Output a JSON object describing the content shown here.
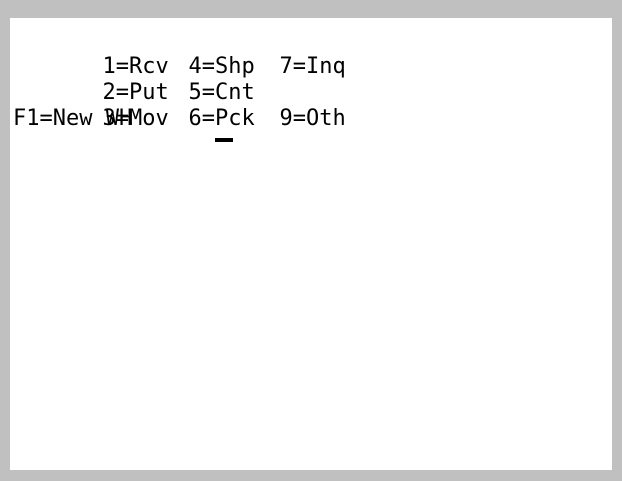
{
  "menu": {
    "rows": [
      [
        "1=Rcv",
        "4=Shp",
        "7=Inq"
      ],
      [
        "2=Put",
        "5=Cnt",
        ""
      ],
      [
        "3=Mov",
        "6=Pck",
        "9=Oth"
      ]
    ],
    "function_key": "F1=New WH"
  },
  "colors": {
    "frame": "#c0c0c0",
    "screen": "#ffffff",
    "text": "#000000"
  }
}
